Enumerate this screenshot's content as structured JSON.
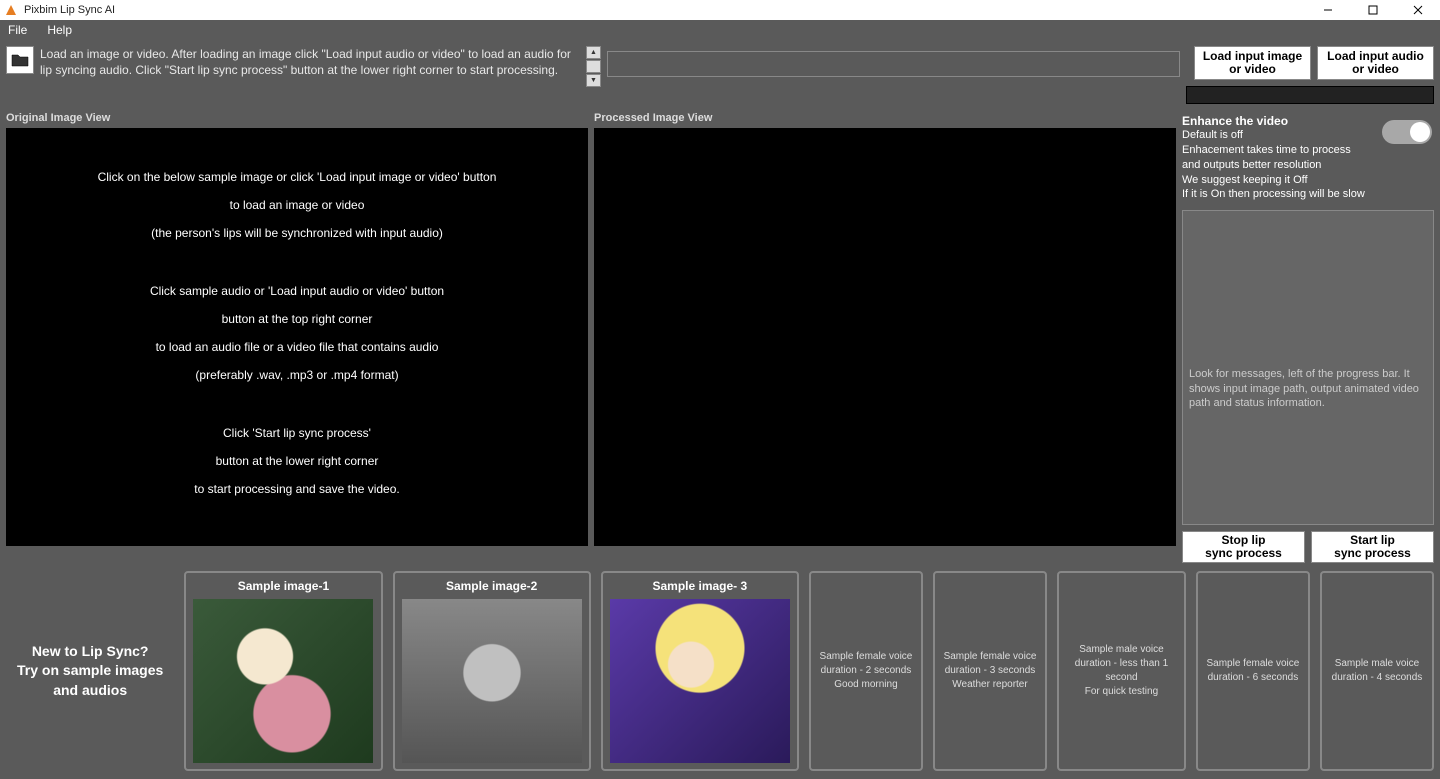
{
  "titlebar": {
    "title": "Pixbim Lip Sync AI"
  },
  "menubar": {
    "file": "File",
    "help": "Help"
  },
  "intro": {
    "text": "Load an image or video. After loading an image click \"Load input audio or video\" to load an audio for lip syncing audio. Click \"Start lip sync process\" button at the lower right corner to start processing."
  },
  "buttons": {
    "load_image": "Load input image\nor video",
    "load_audio": "Load input audio\nor video",
    "stop": "Stop lip\nsync process",
    "start": "Start lip\nsync process"
  },
  "views": {
    "original_label": "Original Image View",
    "processed_label": "Processed Image View",
    "p1l1": "Click on the below sample image or click 'Load input image or video' button",
    "p1l2": "to load an image or video",
    "p1l3": "(the person's lips will be synchronized with input audio)",
    "p2l1": "Click sample audio or 'Load input audio or video' button",
    "p2l2": "button at the top right corner",
    "p2l3": "to load an audio file or a video file that contains audio",
    "p2l4": "(preferably .wav, .mp3 or .mp4 format)",
    "p3l1": "Click 'Start lip sync process'",
    "p3l2": "button at the lower right corner",
    "p3l3": "to start processing and save the video."
  },
  "enhance": {
    "title": "Enhance the video",
    "l1": "Default is off",
    "l2": "Enhacement takes time to process",
    "l3": "and outputs better resolution",
    "l4": "We suggest keeping it Off",
    "l5": "If it is On then processing will be slow"
  },
  "messages": {
    "text": "Look for messages, left of the progress bar. It shows input image path, output animated video path and status information."
  },
  "samples_intro": "New to Lip Sync?\nTry on sample images\nand audios",
  "samples": {
    "img1": "Sample image-1",
    "img2": "Sample image-2",
    "img3": "Sample image- 3",
    "a1l1": "Sample female voice",
    "a1l2": "duration - 2 seconds",
    "a1l3": "Good morning",
    "a2l1": "Sample female voice",
    "a2l2": "duration - 3 seconds",
    "a2l3": "Weather reporter",
    "a3l1": "Sample male voice",
    "a3l2": "duration - less than 1 second",
    "a3l3": "For quick testing",
    "a4l1": "Sample female voice",
    "a4l2": "duration - 6 seconds",
    "a5l1": "Sample male voice",
    "a5l2": "duration - 4 seconds"
  }
}
